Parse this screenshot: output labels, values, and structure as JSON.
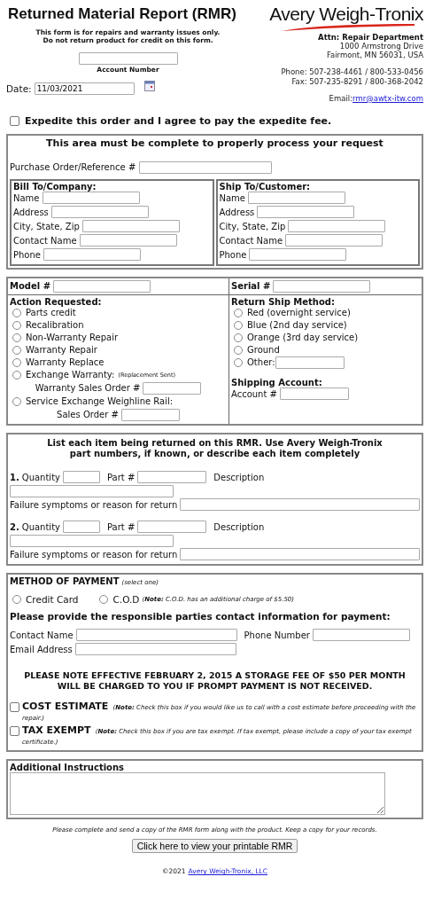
{
  "header": {
    "title": "Returned Material Report (RMR)",
    "notice": [
      "This form is for repairs and warranty issues only.",
      "Do not return product for credit on this form."
    ],
    "account_label": "Account Number",
    "date_label": "Date:",
    "date_value": "11/03/2021"
  },
  "company": {
    "logo": "Avery Weigh-Tronix",
    "attn": "Attn: Repair Department",
    "address": [
      "1000 Armstrong Drive",
      "Fairmont, MN 56031, USA"
    ],
    "phones": [
      "Phone: 507-238-4461 / 800-533-0456",
      "Fax: 507-235-8291 / 800-368-2042"
    ],
    "email_label": "Email:",
    "email": "rmr@awtx-itw.com"
  },
  "expedite": {
    "label": "Expedite this order and I agree to pay the expedite fee.",
    "checked": false
  },
  "required": {
    "heading": "This area must be complete to properly process your request",
    "po_label": "Purchase Order/Reference #",
    "parties": [
      {
        "heading": "Bill To/Company:",
        "fields": [
          "Name",
          "Address",
          "City, State, Zip",
          "Contact Name",
          "Phone"
        ]
      },
      {
        "heading": "Ship To/Customer:",
        "fields": [
          "Name",
          "Address",
          "City, State, Zip",
          "Contact Name",
          "Phone"
        ]
      }
    ]
  },
  "product": {
    "model_label": "Model #",
    "serial_label": "Serial #",
    "action": {
      "heading": "Action Requested:",
      "options": [
        {
          "label": "Parts credit",
          "selected": false
        },
        {
          "label": "Recalibration",
          "selected": false
        },
        {
          "label": "Non-Warranty Repair",
          "selected": false
        },
        {
          "label": "Warranty Repair",
          "selected": false
        },
        {
          "label": "Warranty Replace",
          "selected": false
        },
        {
          "label": "Exchange Warranty:",
          "selected": false,
          "note": "(Replacement Sent)",
          "sub_label": "Warranty Sales Order #"
        },
        {
          "label": "Service Exchange Weighline Rail:",
          "selected": false,
          "sub_label": "Sales Order #"
        }
      ]
    },
    "ship_method": {
      "heading": "Return Ship Method:",
      "options": [
        {
          "label": "Red (overnight service)",
          "selected": false
        },
        {
          "label": "Blue (2nd day service)",
          "selected": false
        },
        {
          "label": "Orange (3rd day service)",
          "selected": false
        },
        {
          "label": "Ground",
          "selected": false
        },
        {
          "label": "Other:",
          "selected": false,
          "inline_field": true
        }
      ]
    },
    "shipping_account": {
      "heading": "Shipping Account:",
      "label": "Account #"
    }
  },
  "items": {
    "heading": [
      "List each item being returned on this RMR. Use Avery Weigh-Tronix",
      "part numbers, if known, or describe each item completely"
    ],
    "rows": [
      {
        "number": "1.",
        "quantity_label": "Quantity",
        "part_label": "Part #",
        "description_label": "Description",
        "failure_label": "Failure symptoms or reason for return"
      },
      {
        "number": "2.",
        "quantity_label": "Quantity",
        "part_label": "Part #",
        "description_label": "Description",
        "failure_label": "Failure symptoms or reason for return"
      }
    ]
  },
  "payment": {
    "heading": "METHOD OF PAYMENT",
    "hint": "(select one)",
    "methods": [
      {
        "label": "Credit Card",
        "selected": false
      },
      {
        "label": "C.O.D",
        "selected": false,
        "note": "(**Note:** C.O.D. has an additional charge of $5.50)"
      }
    ],
    "contact_heading": "Please provide the responsible parties contact information for payment:",
    "contact_label": "Contact Name",
    "phone_label": "Phone Number",
    "email_label": "Email Address",
    "storage_notice": [
      "PLEASE NOTE EFFECTIVE FEBRUARY 2, 2015 A STORAGE FEE OF $50 PER MONTH",
      "WILL BE CHARGED TO YOU IF PROMPT PAYMENT IS NOT RECEIVED."
    ],
    "options": [
      {
        "label": "COST ESTIMATE",
        "checked": false,
        "note": "(**Note:** Check this box if you would like us to call with a cost estimate before proceeding with the repair.)"
      },
      {
        "label": "TAX EXEMPT",
        "checked": false,
        "note": "(**Note:** Check this box if you are tax exempt. If tax exempt, please include a copy of your tax exempt certificate.)"
      }
    ]
  },
  "instructions": {
    "heading": "Additional Instructions"
  },
  "footer": {
    "note": "Please complete and send a copy of the RMR form along with the product. Keep a copy for your records.",
    "button": "Click here to view your printable RMR",
    "copyright": "©2021",
    "link": "Avery Weigh-Tronix, LLC"
  }
}
